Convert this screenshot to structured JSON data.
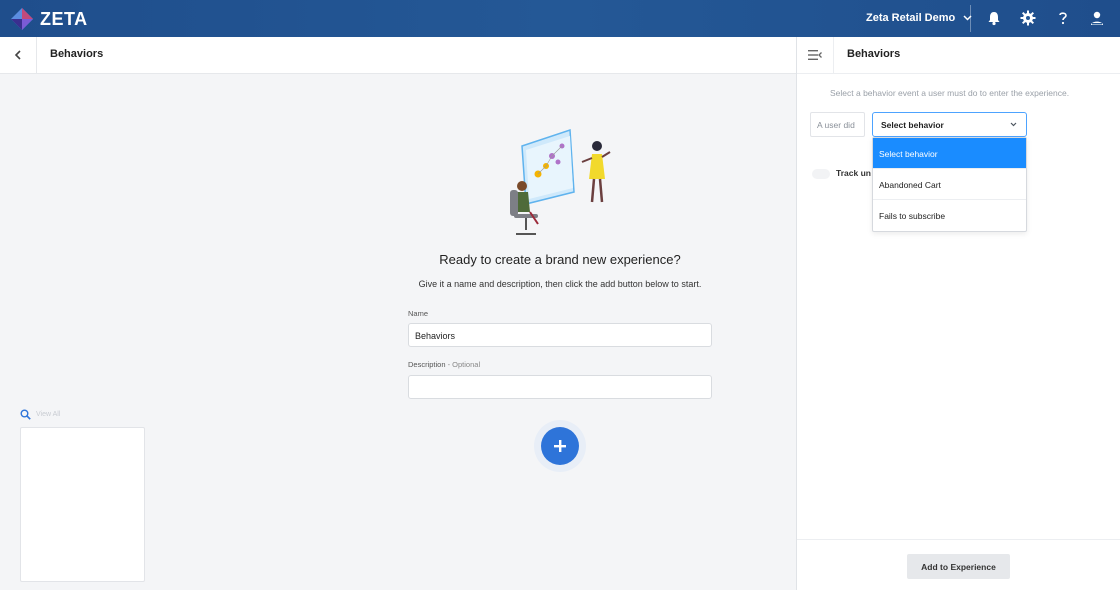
{
  "header": {
    "brand": "ZETA",
    "account_name": "Zeta Retail Demo",
    "icons": [
      "bell-icon",
      "gear-icon",
      "help-icon",
      "user-icon"
    ]
  },
  "editor": {
    "title": "Behaviors",
    "headline": "Ready to create a brand new experience?",
    "subline": "Give it a name and description, then click the add button below to start.",
    "name_label": "Name",
    "name_value": "Behaviors",
    "description_label": "Description",
    "description_optional": " - Optional",
    "description_value": ""
  },
  "sidebar_mini": {
    "view_all": "View All"
  },
  "panel": {
    "title": "Behaviors",
    "hint": "Select a behavior event a user must do to enter the experience.",
    "user_did_label": "A user did",
    "select_value": "Select behavior",
    "track_label": "Track un",
    "dropdown_options": [
      "Select behavior",
      "Abandoned Cart",
      "Fails to subscribe"
    ],
    "selected_option": "Select behavior",
    "add_button": "Add to Experience"
  },
  "colors": {
    "topbar": "#245896",
    "accent": "#2e74d9",
    "dropdown_active": "#1a8cff"
  }
}
